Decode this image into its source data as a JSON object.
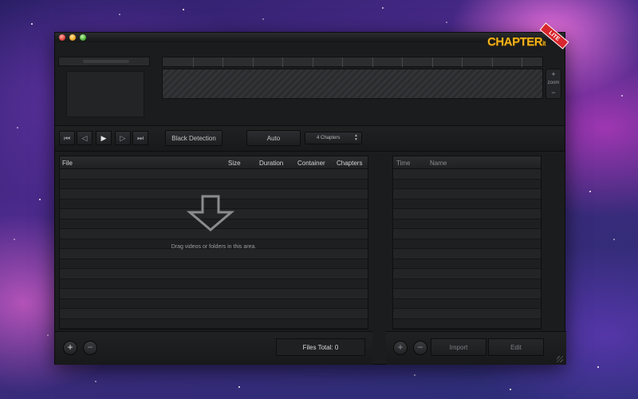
{
  "app": {
    "logo_main": "CHAPTER",
    "logo_sub": "it",
    "badge": "LITE"
  },
  "timeline": {
    "zoom_plus": "+",
    "zoom_label": "zoom",
    "zoom_minus": "−"
  },
  "toolbar": {
    "transport": [
      {
        "name": "skip-start-icon",
        "glyph": "⏮"
      },
      {
        "name": "prev-icon",
        "glyph": "◁"
      },
      {
        "name": "play-icon",
        "glyph": "▶"
      },
      {
        "name": "next-icon",
        "glyph": "▷"
      },
      {
        "name": "skip-end-icon",
        "glyph": "⏭"
      }
    ],
    "black_detection": "Black Detection",
    "auto": "Auto",
    "chapters_select": "4 Chapters"
  },
  "file_table": {
    "columns": [
      "File",
      "Size",
      "Duration",
      "Container",
      "Chapters"
    ],
    "drop_hint": "Drag videos or folders in this area."
  },
  "chapter_table": {
    "columns": [
      "Time",
      "Name"
    ]
  },
  "bottom": {
    "add": "+",
    "remove": "−",
    "files_total": "Files Total: 0",
    "import": "Import",
    "edit": "Edit"
  }
}
